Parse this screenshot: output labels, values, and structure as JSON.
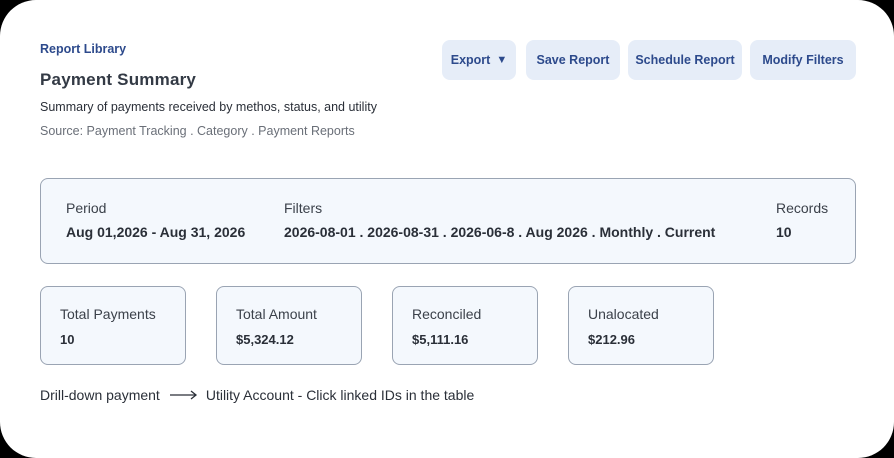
{
  "header": {
    "breadcrumb": "Report Library",
    "title": "Payment Summary",
    "subtitle": "Summary of payments received by methos, status, and utility",
    "source": "Source: Payment Tracking . Category . Payment Reports"
  },
  "toolbar": {
    "export_label": "Export",
    "save_label": "Save Report",
    "schedule_label": "Schedule Report",
    "modify_label": "Modify Filters"
  },
  "meta": {
    "period_label": "Period",
    "period_value": "Aug 01,2026 - Aug 31, 2026",
    "filters_label": "Filters",
    "filters_value": "2026-08-01 . 2026-08-31 . 2026-06-8 . Aug 2026 . Monthly . Current",
    "records_label": "Records",
    "records_value": "10"
  },
  "stats": [
    {
      "label": "Total Payments",
      "value": "10"
    },
    {
      "label": "Total Amount",
      "value": "$5,324.12"
    },
    {
      "label": "Reconciled",
      "value": "$5,111.16"
    },
    {
      "label": "Unalocated",
      "value": "$212.96"
    }
  ],
  "drilldown": {
    "from": "Drill-down payment",
    "to": "Utility Account - Click linked IDs in the table"
  },
  "colors": {
    "accent": "#2d4a8c",
    "button_bg": "#e6edf8",
    "panel_bg": "#f4f8fd",
    "panel_border": "#9aa4b3"
  }
}
